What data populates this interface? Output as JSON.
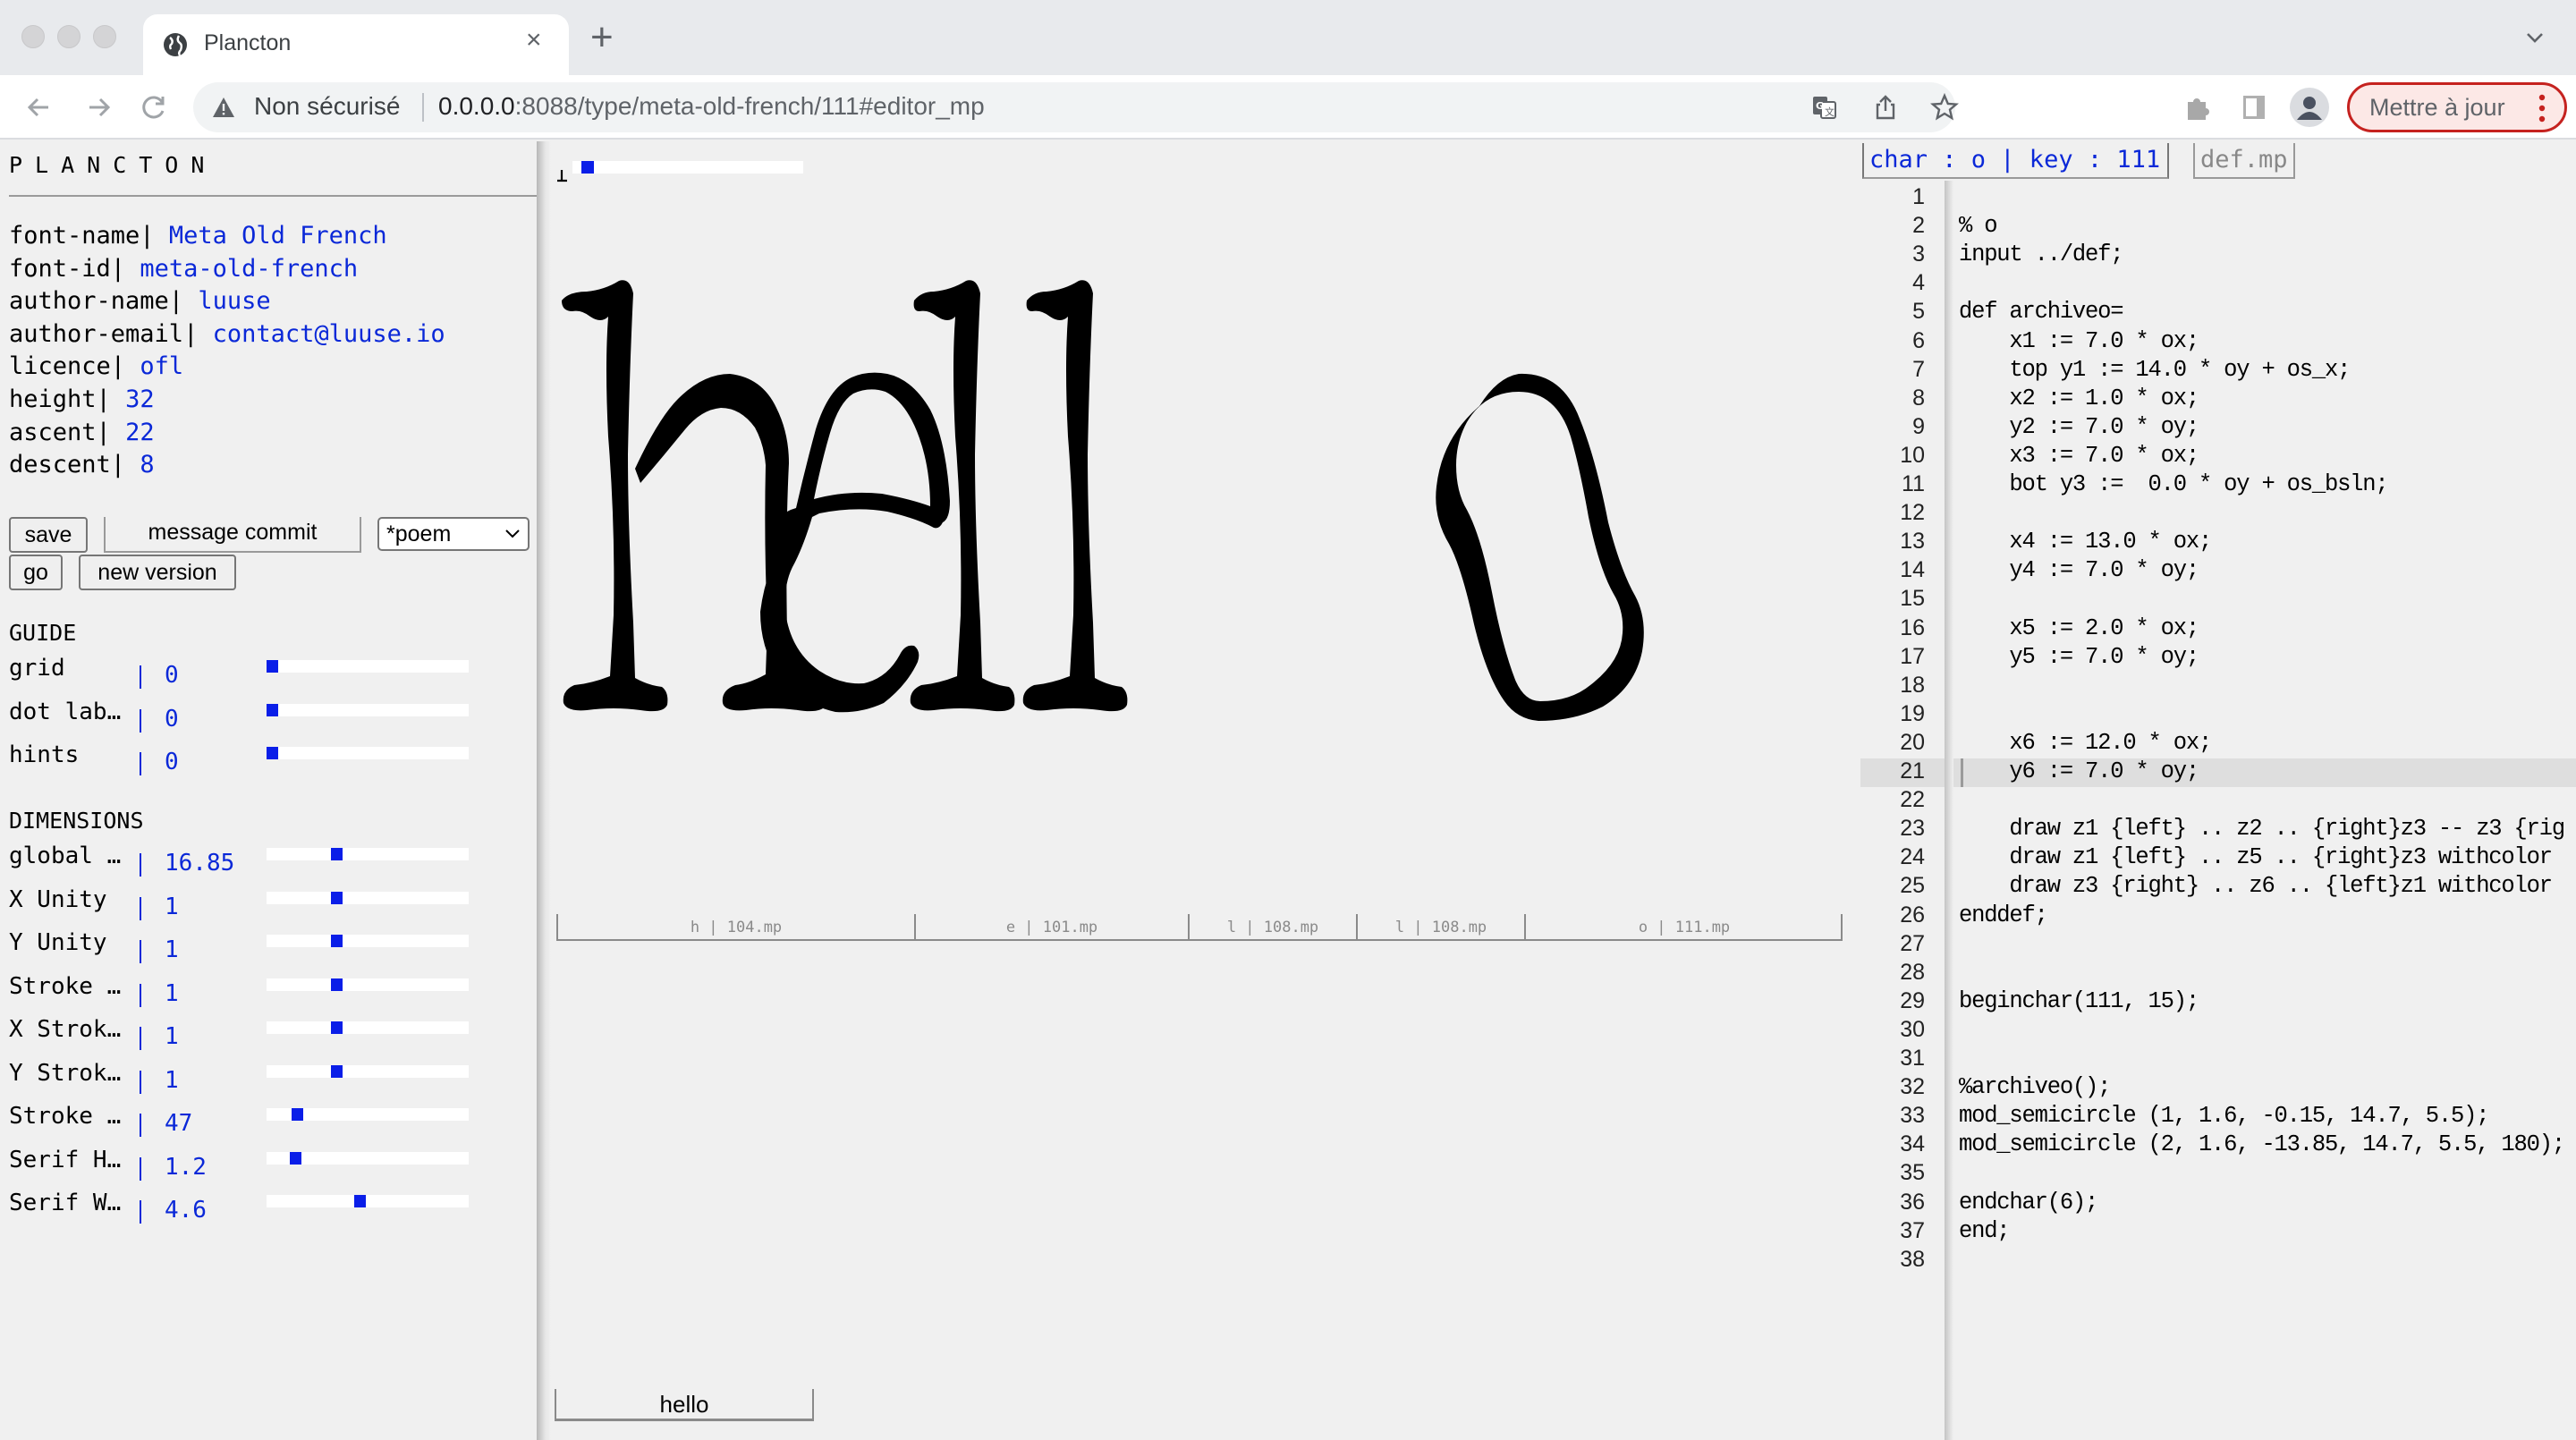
{
  "browser": {
    "tab_title": "Plancton",
    "tab_close": "×",
    "new_tab": "+",
    "security_label": "Non sécurisé",
    "url_host": "0.0.0.0",
    "url_rest": ":8088/type/meta-old-french/111#editor_mp",
    "update_button": "Mettre à jour",
    "icons": [
      "back-arrow-icon",
      "forward-arrow-icon",
      "reload-icon",
      "warning-icon",
      "translate-icon",
      "share-icon",
      "bookmark-star-icon",
      "extensions-puzzle-icon",
      "side-panel-icon",
      "profile-avatar-icon",
      "kebab-menu-icon",
      "tab-search-chevron-icon"
    ]
  },
  "app": {
    "brand": "PLANCTON",
    "meta": [
      {
        "key": "font-name|",
        "value": "Meta Old French"
      },
      {
        "key": "font-id|",
        "value": "meta-old-french"
      },
      {
        "key": "author-name|",
        "value": "luuse"
      },
      {
        "key": "author-email|",
        "value": "contact@luuse.io"
      },
      {
        "key": "licence|",
        "value": "ofl"
      },
      {
        "key": "height|",
        "value": "32"
      },
      {
        "key": "ascent|",
        "value": "22"
      },
      {
        "key": "descent|",
        "value": "8"
      }
    ],
    "buttons": {
      "save": "save",
      "message_commit": "message commit",
      "go": "go",
      "new_version": "new version"
    },
    "version_select": {
      "selected": "*poem"
    },
    "guide": {
      "title": "GUIDE",
      "params": [
        {
          "label": "grid",
          "value": "0",
          "position": 0.0
        },
        {
          "label": "dot lab…",
          "value": "0",
          "position": 0.0
        },
        {
          "label": "hints",
          "value": "0",
          "position": 0.0
        }
      ]
    },
    "dimensions": {
      "title": "DIMENSIONS",
      "params": [
        {
          "label": "global …",
          "value": "16.85",
          "position": 0.34
        },
        {
          "label": "X Unity",
          "value": "1",
          "position": 0.34
        },
        {
          "label": "Y Unity",
          "value": "1",
          "position": 0.34
        },
        {
          "label": "Stroke …",
          "value": "1",
          "position": 0.34
        },
        {
          "label": "X Strok…",
          "value": "1",
          "position": 0.34
        },
        {
          "label": "Y Strok…",
          "value": "1",
          "position": 0.34
        },
        {
          "label": "Stroke …",
          "value": "47",
          "position": 0.13
        },
        {
          "label": "Serif H…",
          "value": "1.2",
          "position": 0.12
        },
        {
          "label": "Serif W…",
          "value": "4.6",
          "position": 0.46
        }
      ]
    }
  },
  "canvas": {
    "zoom_position": 0.04,
    "preview_text": "hello",
    "glyph_ruler": [
      {
        "char": "h",
        "file": "104.mp",
        "label": "h | 104.mp"
      },
      {
        "char": "e",
        "file": "101.mp",
        "label": "e | 101.mp"
      },
      {
        "char": "l",
        "file": "108.mp",
        "label": "l | 108.mp"
      },
      {
        "char": "l",
        "file": "108.mp",
        "label": "l | 108.mp"
      },
      {
        "char": "o",
        "file": "111.mp",
        "label": "o | 111.mp"
      }
    ],
    "text_input_value": "hello"
  },
  "editor": {
    "tab_char": "char : o | key : 111",
    "tab_def": "def.mp",
    "active_line": 21,
    "lines": [
      "",
      "% o",
      "input ../def;",
      "",
      "def archiveo=",
      "    x1 := 7.0 * ox;",
      "    top y1 := 14.0 * oy + os_x;",
      "    x2 := 1.0 * ox;",
      "    y2 := 7.0 * oy;",
      "    x3 := 7.0 * ox;",
      "    bot y3 :=  0.0 * oy + os_bsln;",
      "",
      "    x4 := 13.0 * ox;",
      "    y4 := 7.0 * oy;",
      "",
      "    x5 := 2.0 * ox;",
      "    y5 := 7.0 * oy;",
      "",
      "",
      "    x6 := 12.0 * ox;",
      "    y6 := 7.0 * oy;",
      "",
      "    draw z1 {left} .. z2 .. {right}z3 -- z3 {rig",
      "    draw z1 {left} .. z5 .. {right}z3 withcolor",
      "    draw z3 {right} .. z6 .. {left}z1 withcolor",
      "enddef;",
      "",
      "",
      "beginchar(111, 15);",
      "",
      "",
      "%archiveo();",
      "mod_semicircle (1, 1.6, -0.15, 14.7, 5.5);",
      "mod_semicircle (2, 1.6, -13.85, 14.7, 5.5, 180);",
      "",
      "endchar(6);",
      "end;",
      ""
    ]
  }
}
